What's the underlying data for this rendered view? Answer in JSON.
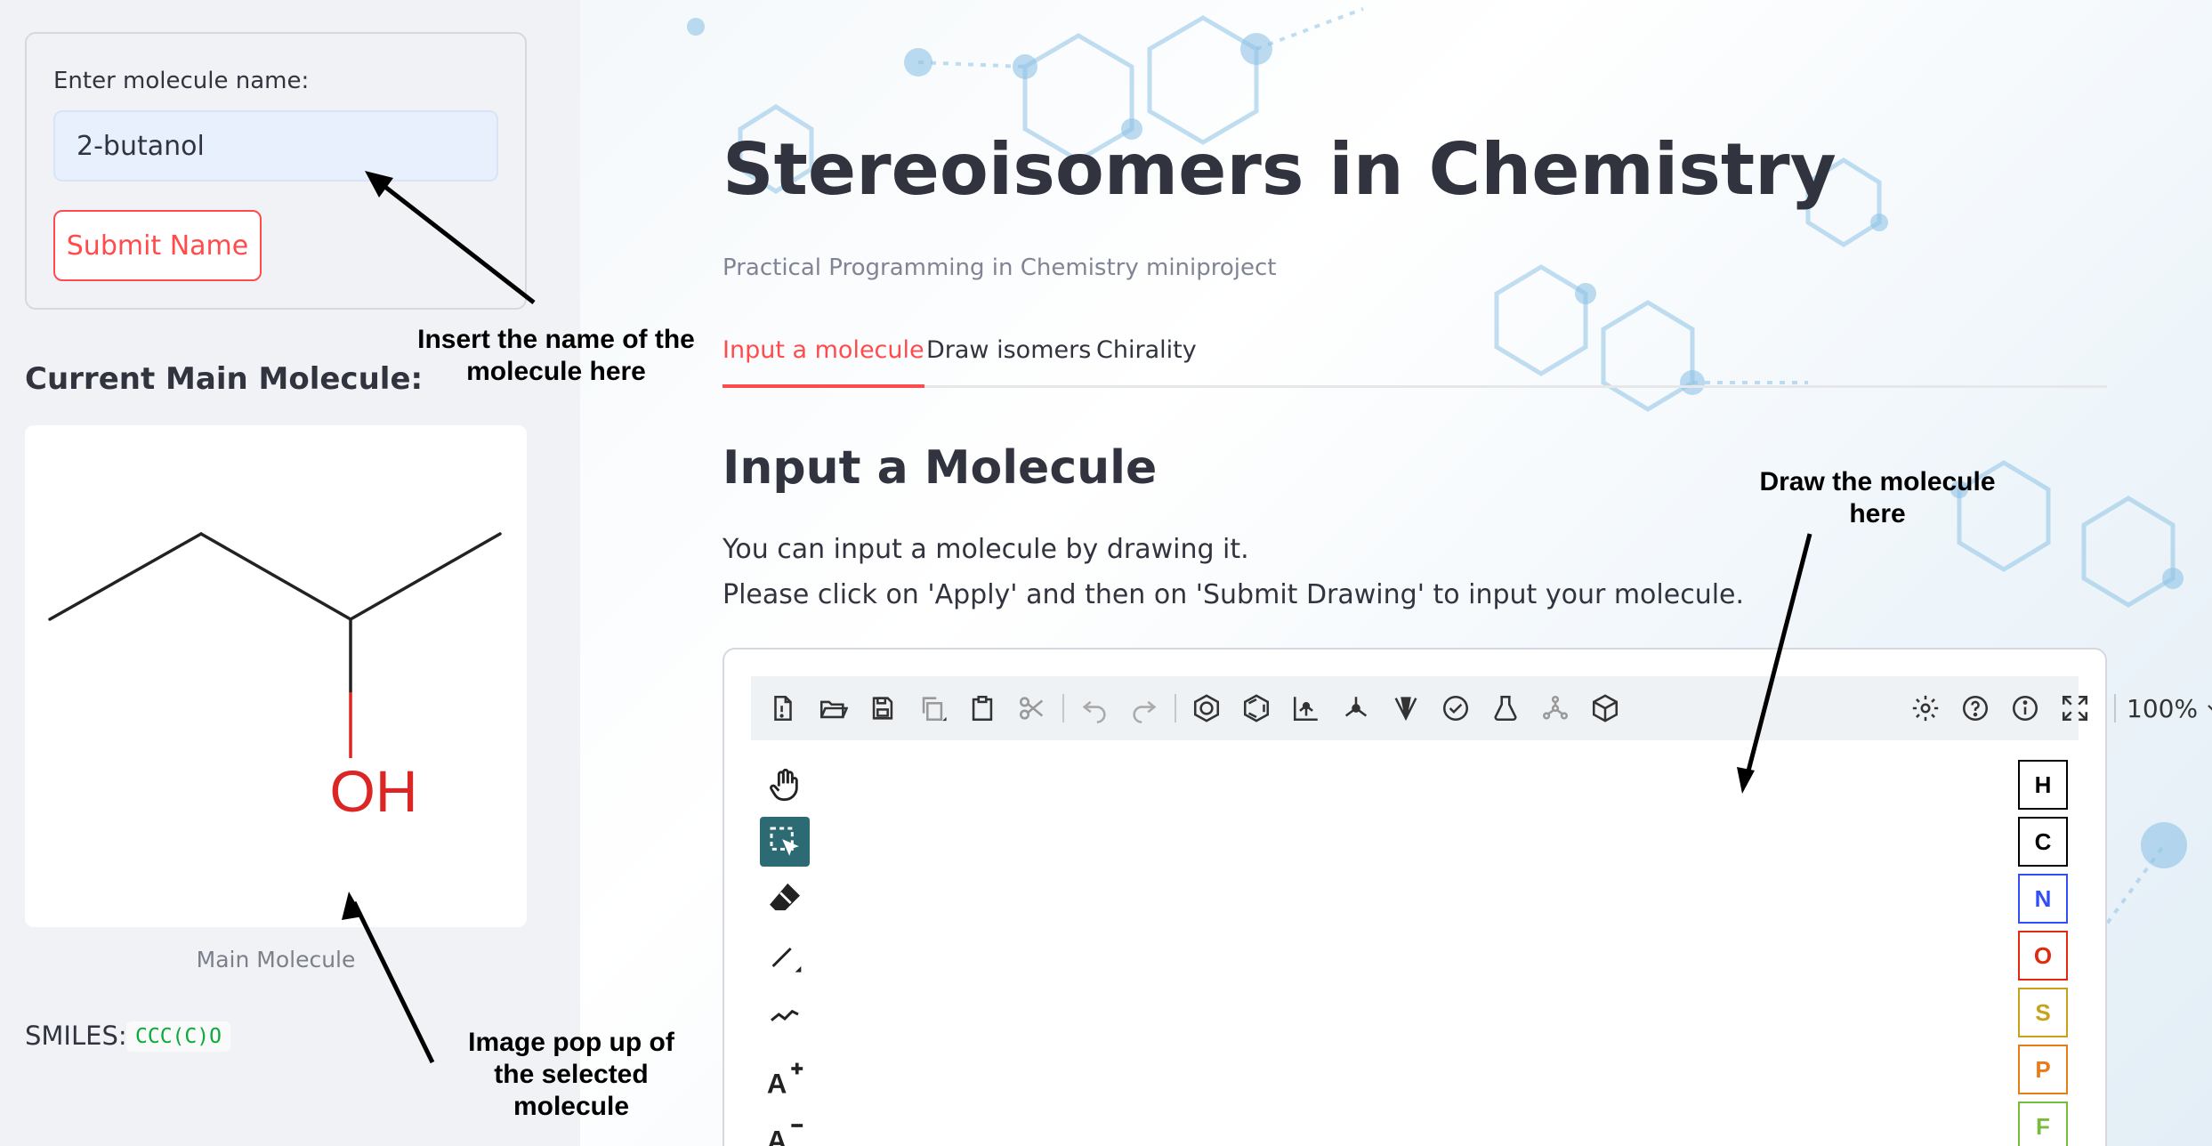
{
  "sidebar": {
    "input_label": "Enter molecule name:",
    "input_value": "2-butanol",
    "submit_label": "Submit Name",
    "current_title": "Current Main Molecule:",
    "molecule_oh_label": "OH",
    "caption": "Main Molecule",
    "smiles_label": "SMILES:",
    "smiles_value": "CCC(C)O"
  },
  "main": {
    "title": "Stereoisomers in Chemistry",
    "subtitle": "Practical Programming in Chemistry miniproject",
    "tabs": [
      {
        "label": "Input a molecule",
        "active": true
      },
      {
        "label": "Draw isomers",
        "active": false
      },
      {
        "label": "Chirality",
        "active": false
      }
    ],
    "section_title": "Input a Molecule",
    "paragraph_1": "You can input a molecule by drawing it.",
    "paragraph_2": "Please click on 'Apply' and then on 'Submit Drawing' to input your molecule."
  },
  "editor": {
    "toolbar_icons": [
      "new-file-icon",
      "open-icon",
      "save-icon",
      "copy-icon",
      "paste-icon",
      "cut-icon",
      "undo-icon",
      "redo-icon",
      "aromatize-icon",
      "dearomatize-icon",
      "layout-icon",
      "clean-up-icon",
      "stereochemistry-icon",
      "check-structure-icon",
      "calculated-values-icon",
      "recognize-molecule-icon",
      "3d-viewer-icon",
      "settings-icon",
      "help-icon",
      "about-icon",
      "fullscreen-icon"
    ],
    "zoom_value": "100%",
    "left_tools": [
      "hand-tool-icon",
      "select-tool-icon",
      "erase-tool-icon",
      "bond-tool-icon",
      "chain-tool-icon",
      "charge-plus-icon",
      "charge-minus-icon"
    ],
    "elements": [
      {
        "symbol": "H",
        "color": "#000000"
      },
      {
        "symbol": "C",
        "color": "#000000"
      },
      {
        "symbol": "N",
        "color": "#304ff7"
      },
      {
        "symbol": "O",
        "color": "#e02a0d"
      },
      {
        "symbol": "S",
        "color": "#c9a21d"
      },
      {
        "symbol": "P",
        "color": "#e97c16"
      },
      {
        "symbol": "F",
        "color": "#78bb3d"
      }
    ]
  },
  "annotations": {
    "insert_name": "Insert the name of the molecule here",
    "draw_here": "Draw the molecule here",
    "image_popup": "Image pop up of the selected molecule"
  },
  "colors": {
    "accent": "#ff4b4b",
    "sidebar_bg": "#f0f2f6",
    "input_bg": "#e8f0fe",
    "smiles_green": "#09ab3b",
    "select_tool_bg": "#2c6a74",
    "oxygen_red": "#dc2626"
  }
}
